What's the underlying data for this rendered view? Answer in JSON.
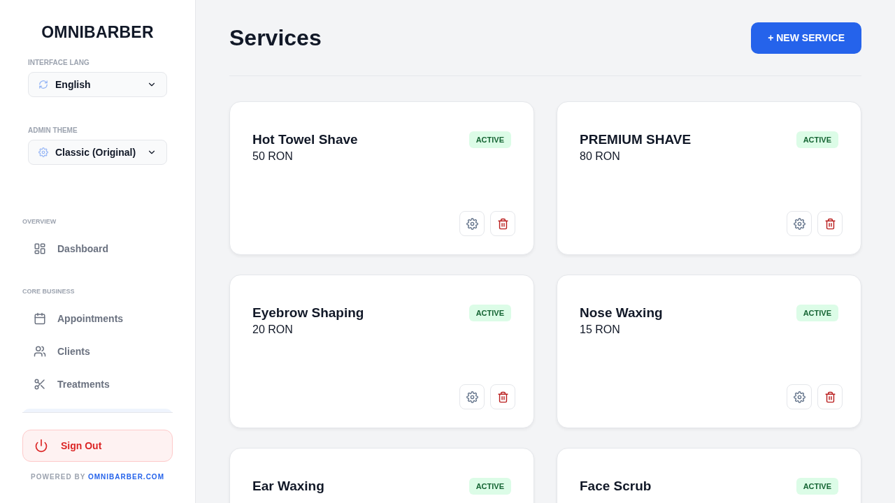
{
  "sidebar": {
    "logo": "OMNIBARBER",
    "selects": [
      {
        "label": "INTERFACE LANG",
        "value": "English",
        "kind": "language"
      },
      {
        "label": "ADMIN THEME",
        "value": "Classic (Original)",
        "kind": "theme"
      }
    ],
    "sections": [
      {
        "title": "OVERVIEW",
        "items": [
          {
            "label": "Dashboard",
            "kind": "dashboard"
          }
        ]
      },
      {
        "title": "CORE BUSINESS",
        "items": [
          {
            "label": "Appointments",
            "kind": "calendar"
          },
          {
            "label": "Clients",
            "kind": "users"
          },
          {
            "label": "Treatments",
            "kind": "scissors"
          }
        ]
      }
    ],
    "sign_out": "Sign Out",
    "powered_by": {
      "prefix": "POWERED BY",
      "link": "OMNIBARBER.COM"
    }
  },
  "page": {
    "title": "Services",
    "new_button": "+ NEW SERVICE"
  },
  "services": [
    {
      "name": "Hot Towel Shave",
      "price": "50 RON",
      "status": "ACTIVE"
    },
    {
      "name": "PREMIUM SHAVE",
      "price": "80 RON",
      "status": "ACTIVE"
    },
    {
      "name": "Eyebrow Shaping",
      "price": "20 RON",
      "status": "ACTIVE"
    },
    {
      "name": "Nose Waxing",
      "price": "15 RON",
      "status": "ACTIVE"
    },
    {
      "name": "Ear Waxing",
      "status": "ACTIVE"
    },
    {
      "name": "Face Scrub",
      "status": "ACTIVE"
    }
  ]
}
